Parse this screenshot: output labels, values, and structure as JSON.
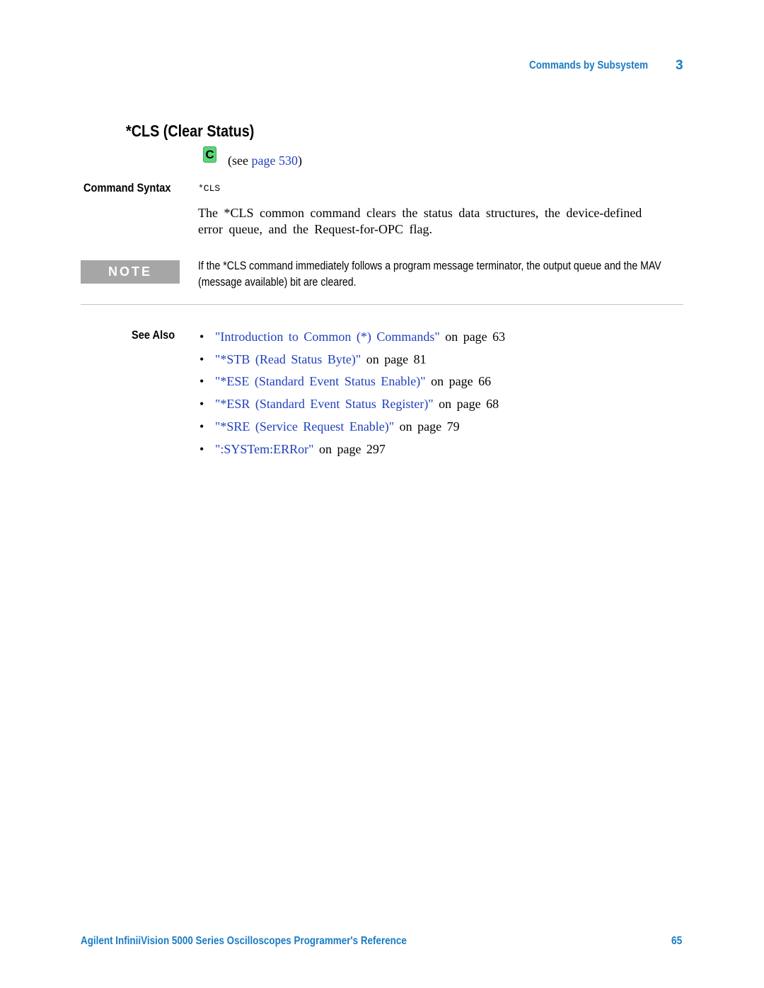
{
  "header": {
    "section": "Commands by Subsystem",
    "chapter": "3"
  },
  "title": "*CLS (Clear Status)",
  "compat_icon": {
    "icon": "c-compatibility-icon",
    "letter": "C",
    "color": "#5ad677"
  },
  "see_page": {
    "prefix": "(see ",
    "link_text": "page 530",
    "suffix": ")"
  },
  "command_syntax": {
    "label": "Command Syntax",
    "code": "*CLS"
  },
  "description": "The *CLS common command clears the status data structures, the device-defined error queue, and the Request-for-OPC flag.",
  "note": {
    "badge": "NOTE",
    "text": "If the *CLS command immediately follows a program message terminator, the output queue and the MAV (message available) bit are cleared."
  },
  "see_also": {
    "label": "See Also",
    "items": [
      {
        "link": "\"Introduction to Common (*) Commands\"",
        "suffix": " on page 63"
      },
      {
        "link": "\"*STB (Read Status Byte)\"",
        "suffix": " on page 81"
      },
      {
        "link": "\"*ESE (Standard Event Status Enable)\"",
        "suffix": " on page 66"
      },
      {
        "link": "\"*ESR (Standard Event Status Register)\"",
        "suffix": " on page 68"
      },
      {
        "link": "\"*SRE (Service Request Enable)\"",
        "suffix": " on page 79"
      },
      {
        "link": "\":SYSTem:ERRor\"",
        "suffix": " on page 297"
      }
    ]
  },
  "footer": {
    "title": "Agilent InfiniiVision 5000 Series Oscilloscopes Programmer's Reference",
    "page_number": "65"
  },
  "colors": {
    "header_blue": "#1a7bc4",
    "link_blue": "#1f3fbf",
    "note_gray": "#a6a6a6"
  }
}
